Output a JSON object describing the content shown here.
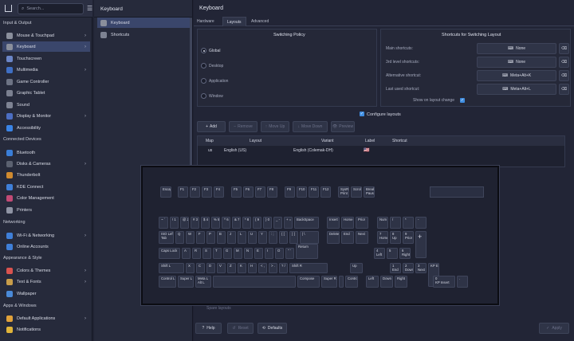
{
  "window": {
    "title": "Keyboard"
  },
  "search": {
    "placeholder": "Search..."
  },
  "sidebar": {
    "sections": [
      "Input & Output",
      "Connected Devices",
      "Networking",
      "Appearance & Style",
      "Apps & Windows"
    ],
    "items": [
      {
        "label": "Mouse & Touchpad",
        "color": "#8a8f9c",
        "chev": true
      },
      {
        "label": "Keyboard",
        "color": "#8a8f9c",
        "chev": true
      },
      {
        "label": "Touchscreen",
        "color": "#6b86c7",
        "chev": false
      },
      {
        "label": "Multimedia",
        "color": "#3f6fc4",
        "chev": true
      },
      {
        "label": "Game Controller",
        "color": "#6d7384",
        "chev": false
      },
      {
        "label": "Graphic Tablet",
        "color": "#7b8090",
        "chev": false
      },
      {
        "label": "Sound",
        "color": "#7e8393",
        "chev": false
      },
      {
        "label": "Display & Monitor",
        "color": "#4c6ec2",
        "chev": true
      },
      {
        "label": "Accessibility",
        "color": "#3a84e6",
        "chev": false
      },
      {
        "label": "Bluetooth",
        "color": "#3a7ed8",
        "chev": false
      },
      {
        "label": "Disks & Cameras",
        "color": "#5b6170",
        "chev": true
      },
      {
        "label": "Thunderbolt",
        "color": "#d08a2f",
        "chev": false
      },
      {
        "label": "KDE Connect",
        "color": "#3f7fd8",
        "chev": false
      },
      {
        "label": "Color Management",
        "color": "#c24a75",
        "chev": false
      },
      {
        "label": "Printers",
        "color": "#8f94a4",
        "chev": false
      },
      {
        "label": "Wi-Fi & Networking",
        "color": "#3f7fd8",
        "chev": true
      },
      {
        "label": "Online Accounts",
        "color": "#3f7fd8",
        "chev": false
      },
      {
        "label": "Colors & Themes",
        "color": "#d9534f",
        "chev": true
      },
      {
        "label": "Text & Fonts",
        "color": "#c89d4a",
        "chev": true
      },
      {
        "label": "Wallpaper",
        "color": "#4a8ad8",
        "chev": false
      },
      {
        "label": "Default Applications",
        "color": "#e0a13a",
        "chev": true
      },
      {
        "label": "Notifications",
        "color": "#e0b43a",
        "chev": false
      }
    ]
  },
  "subpane": {
    "title": "Keyboard",
    "items": [
      "Keyboard",
      "Shortcuts"
    ]
  },
  "tabs": [
    "Hardware",
    "Layouts",
    "Advanced"
  ],
  "switching_policy": {
    "title": "Switching Policy",
    "options": [
      "Global",
      "Desktop",
      "Application",
      "Window"
    ],
    "selected": 0
  },
  "shortcuts": {
    "title": "Shortcuts for Switching Layout",
    "rows": [
      {
        "label": "Main shortcuts:",
        "value": "None"
      },
      {
        "label": "3rd level shortcuts:",
        "value": "None"
      },
      {
        "label": "Alternative shortcut:",
        "value": "Meta+Alt+K"
      },
      {
        "label": "Last used shortcut:",
        "value": "Meta+Alt+L"
      }
    ],
    "osd_label": "Show on layout change"
  },
  "configure_layouts": "Configure layouts",
  "layout_toolbar": [
    "Add",
    "Remove",
    "Move Up",
    "Move Down",
    "Preview"
  ],
  "layout_table": {
    "headers": [
      "Map",
      "Layout",
      "Variant",
      "Label",
      "Shortcut"
    ],
    "row": {
      "map": "us",
      "layout": "English (US)",
      "variant": "English (Colemak-DH)",
      "label": "🇺🇸",
      "shortcut": ""
    }
  },
  "hidden_label": "Spare layouts",
  "footer": {
    "help": "Help",
    "reset": "Reset",
    "defaults": "Defaults",
    "apply": "Apply"
  },
  "keyboard_rows": [
    [
      {
        "t": "Escape"
      },
      null,
      {
        "t": "F1"
      },
      {
        "t": "F2"
      },
      {
        "t": "F3"
      },
      {
        "t": "F4"
      },
      null,
      {
        "t": "F5"
      },
      {
        "t": "F6"
      },
      {
        "t": "F7"
      },
      {
        "t": "F8"
      },
      null,
      {
        "t": "F9"
      },
      {
        "t": "F10"
      },
      {
        "t": "F11"
      },
      {
        "t": "F12"
      },
      null,
      {
        "t": "SysRq\nPrint"
      },
      {
        "t": "Scroll"
      },
      {
        "t": "Break\nPause"
      }
    ],
    [
      {
        "t": "~ `"
      },
      {
        "t": "! 1"
      },
      {
        "t": "@ 2"
      },
      {
        "t": "# 3"
      },
      {
        "t": "$ 4"
      },
      {
        "t": "% 5"
      },
      {
        "t": "^ 6"
      },
      {
        "t": "& 7"
      },
      {
        "t": "* 8"
      },
      {
        "t": "( 9"
      },
      {
        "t": ") 0"
      },
      {
        "t": "_ -"
      },
      {
        "t": "+ ="
      },
      {
        "t": "BackSpace"
      },
      null,
      {
        "t": "Insert"
      },
      {
        "t": "Home"
      },
      {
        "t": "Prior"
      },
      null,
      {
        "t": "Num"
      },
      {
        "t": "/"
      },
      {
        "t": "*"
      },
      {
        "t": "-"
      }
    ],
    [
      {
        "t": "ISO Left\nTab"
      },
      {
        "t": "Q"
      },
      {
        "t": "W"
      },
      {
        "t": "F"
      },
      {
        "t": "P"
      },
      {
        "t": "B"
      },
      {
        "t": "J"
      },
      {
        "t": "L"
      },
      {
        "t": "U"
      },
      {
        "t": "Y"
      },
      {
        "t": ": ;"
      },
      {
        "t": "{ ["
      },
      {
        "t": "} ]"
      },
      {
        "t": "| \\"
      },
      null,
      {
        "t": "Delete"
      },
      {
        "t": "End"
      },
      {
        "t": "Next"
      },
      null,
      {
        "t": "7\nHome"
      },
      {
        "t": "8\nUp"
      },
      {
        "t": "9\nPrior"
      },
      {
        "t": "+"
      }
    ],
    [
      {
        "t": "Caps Lock"
      },
      {
        "t": "A"
      },
      {
        "t": "R"
      },
      {
        "t": "S"
      },
      {
        "t": "T"
      },
      {
        "t": "G"
      },
      {
        "t": "M"
      },
      {
        "t": "N"
      },
      {
        "t": "E"
      },
      {
        "t": "I"
      },
      {
        "t": "O"
      },
      {
        "t": "\" '"
      },
      {
        "t": "Return"
      },
      null,
      null,
      {
        "t": "4\nLeft"
      },
      {
        "t": "5"
      },
      {
        "t": "6\nRight"
      }
    ],
    [
      {
        "t": "Shift L"
      },
      {
        "t": "X"
      },
      {
        "t": "C"
      },
      {
        "t": "D"
      },
      {
        "t": "V"
      },
      {
        "t": "Z"
      },
      {
        "t": "K"
      },
      {
        "t": "H"
      },
      {
        "t": "< ,"
      },
      {
        "t": "> ."
      },
      {
        "t": "? /"
      },
      {
        "t": "Shift R"
      },
      null,
      {
        "t": "Up"
      },
      null,
      {
        "t": "1\nEnd"
      },
      {
        "t": "2\nDown"
      },
      {
        "t": "3\nNext"
      },
      {
        "t": "KP Enter"
      }
    ],
    [
      {
        "t": "Control L"
      },
      {
        "t": "Super L"
      },
      {
        "t": "Meta L\nAlt L"
      },
      {
        "t": ""
      },
      {
        "t": "Compose"
      },
      {
        "t": "Super R"
      },
      {
        "t": ""
      },
      {
        "t": "Control"
      },
      null,
      {
        "t": "Left"
      },
      {
        "t": "Down"
      },
      {
        "t": "Right"
      },
      null,
      {
        "t": "0\nKP Insert"
      },
      {
        "t": "."
      }
    ]
  ]
}
